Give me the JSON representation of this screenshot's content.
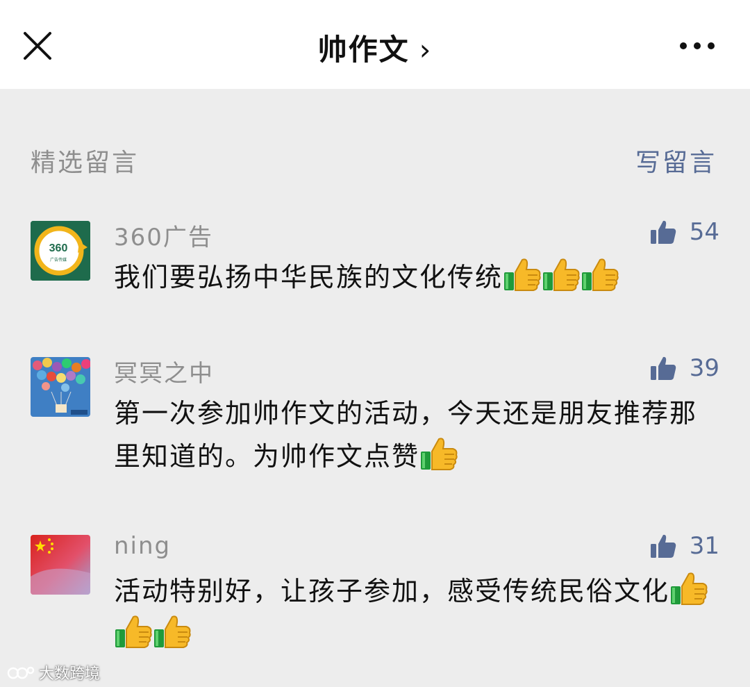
{
  "header": {
    "title": "帅作文",
    "title_chevron": "›"
  },
  "section": {
    "label": "精选留言",
    "write_label": "写留言"
  },
  "comments": [
    {
      "nickname": "360广告",
      "likes": "54",
      "text": "我们要弘扬中华民族的文化传统",
      "thumb_emoji_count": 3,
      "avatar_text": "360",
      "avatar_subtext": "广告传媒"
    },
    {
      "nickname": "冥冥之中",
      "likes": "39",
      "text": "第一次参加帅作文的活动，今天还是朋友推荐那里知道的。为帅作文点赞",
      "thumb_emoji_count": 1
    },
    {
      "nickname": "ning",
      "likes": "31",
      "text": "活动特别好，让孩子参加，感受传统民俗文化",
      "thumb_emoji_count": 3
    }
  ],
  "watermark": {
    "text": "大数跨境"
  },
  "colors": {
    "link": "#576b95",
    "muted": "#8e8e8e",
    "background": "#ededed",
    "topbar": "#ffffff"
  }
}
